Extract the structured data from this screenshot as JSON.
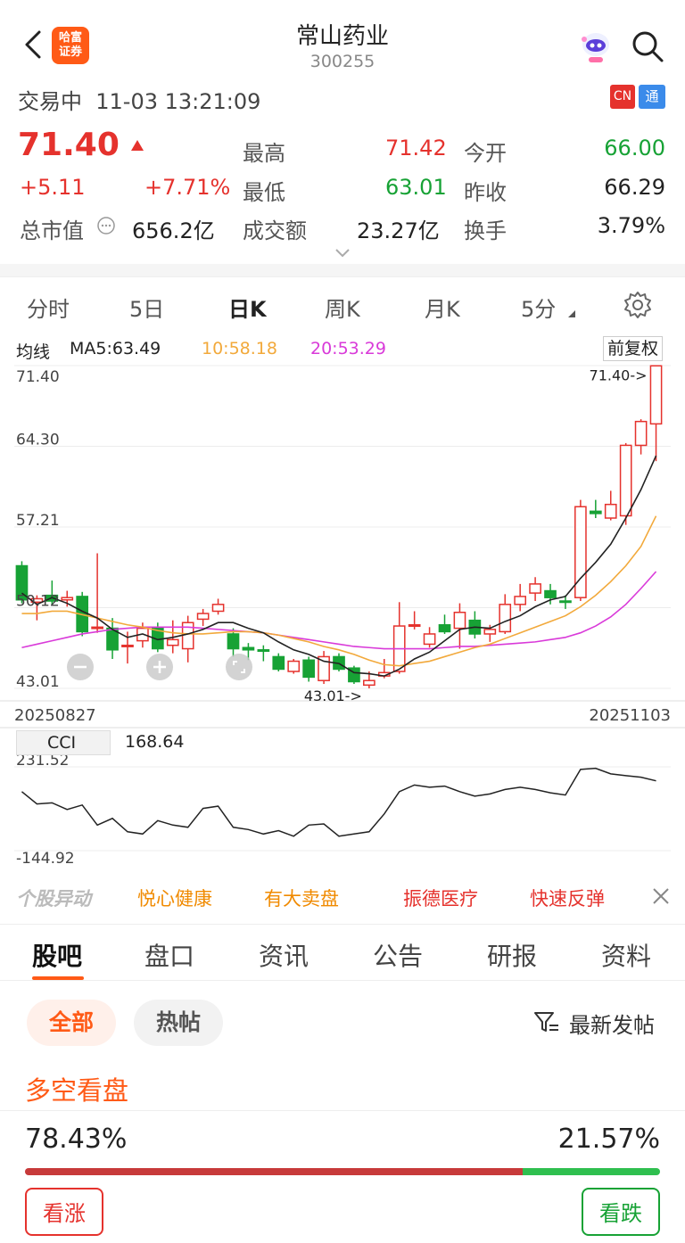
{
  "header": {
    "logo_text": "哈富\n证券",
    "title": "常山药业",
    "code": "300255"
  },
  "status": {
    "text": "交易中  11-03 13:21:09",
    "badge_cn": "CN",
    "badge_tong": "通"
  },
  "quote": {
    "price": "71.40",
    "change": "+5.11",
    "change_pct": "+7.71%",
    "market_cap_label": "总市值",
    "market_cap": "656.2亿",
    "high_label": "最高",
    "high": "71.42",
    "low_label": "最低",
    "low": "63.01",
    "turnover_amount_label": "成交额",
    "turnover_amount": "23.27亿",
    "open_label": "今开",
    "open": "66.00",
    "prev_close_label": "昨收",
    "prev_close": "66.29",
    "turnover_rate_label": "换手",
    "turnover_rate": "3.79%"
  },
  "kline_tabs": [
    "分时",
    "5日",
    "日K",
    "周K",
    "月K",
    "5分"
  ],
  "kline_active": "日K",
  "ma_legend": {
    "label": "均线",
    "ma5": "MA5:63.49",
    "ma10": "10:58.18",
    "ma20": "20:53.29",
    "restore": "前复权",
    "colors": {
      "ma5": "#222222",
      "ma10": "#f2a93b",
      "ma20": "#d93ad9"
    }
  },
  "chart_data": {
    "type": "candlestick",
    "y_ticks": [
      "71.40",
      "64.30",
      "57.21",
      "50.12",
      "43.01"
    ],
    "ylim": [
      43.01,
      71.42
    ],
    "date_start": "20250827",
    "date_end": "20251103",
    "max_label": "71.40->",
    "min_label": "43.01->",
    "candles": [
      {
        "o": 53.8,
        "c": 50.8,
        "h": 54.2,
        "l": 50.5
      },
      {
        "o": 50.6,
        "c": 50.9,
        "h": 51.2,
        "l": 49.0
      },
      {
        "o": 51.2,
        "c": 50.7,
        "h": 52.5,
        "l": 50.3
      },
      {
        "o": 50.8,
        "c": 51.0,
        "h": 51.6,
        "l": 50.2
      },
      {
        "o": 51.1,
        "c": 48.0,
        "h": 51.5,
        "l": 47.6
      },
      {
        "o": 48.3,
        "c": 48.4,
        "h": 54.9,
        "l": 47.9
      },
      {
        "o": 48.3,
        "c": 46.4,
        "h": 49.2,
        "l": 45.6
      },
      {
        "o": 46.7,
        "c": 46.8,
        "h": 48.0,
        "l": 45.2
      },
      {
        "o": 47.2,
        "c": 48.3,
        "h": 48.8,
        "l": 46.6
      },
      {
        "o": 48.3,
        "c": 46.5,
        "h": 48.8,
        "l": 46.2
      },
      {
        "o": 46.8,
        "c": 47.3,
        "h": 49.0,
        "l": 46.1
      },
      {
        "o": 46.5,
        "c": 48.8,
        "h": 49.4,
        "l": 45.3
      },
      {
        "o": 49.1,
        "c": 49.6,
        "h": 50.0,
        "l": 48.5
      },
      {
        "o": 49.8,
        "c": 50.4,
        "h": 50.9,
        "l": 49.5
      },
      {
        "o": 47.8,
        "c": 46.5,
        "h": 48.3,
        "l": 45.8
      },
      {
        "o": 46.6,
        "c": 46.4,
        "h": 47.0,
        "l": 45.5
      },
      {
        "o": 46.4,
        "c": 46.3,
        "h": 46.8,
        "l": 45.4
      },
      {
        "o": 45.8,
        "c": 44.7,
        "h": 46.1,
        "l": 44.5
      },
      {
        "o": 44.5,
        "c": 45.4,
        "h": 45.6,
        "l": 44.3
      },
      {
        "o": 45.5,
        "c": 44.0,
        "h": 45.8,
        "l": 43.6
      },
      {
        "o": 43.7,
        "c": 45.8,
        "h": 46.3,
        "l": 43.4
      },
      {
        "o": 45.8,
        "c": 44.7,
        "h": 46.1,
        "l": 44.5
      },
      {
        "o": 44.8,
        "c": 43.6,
        "h": 45.0,
        "l": 43.4
      },
      {
        "o": 43.3,
        "c": 43.7,
        "h": 44.5,
        "l": 43.01
      },
      {
        "o": 44.1,
        "c": 44.4,
        "h": 45.6,
        "l": 43.9
      },
      {
        "o": 44.5,
        "c": 48.5,
        "h": 50.6,
        "l": 44.3
      },
      {
        "o": 48.5,
        "c": 48.6,
        "h": 49.8,
        "l": 48.2
      },
      {
        "o": 46.9,
        "c": 47.8,
        "h": 48.4,
        "l": 46.6
      },
      {
        "o": 48.6,
        "c": 48.0,
        "h": 49.5,
        "l": 47.8
      },
      {
        "o": 48.3,
        "c": 49.7,
        "h": 50.5,
        "l": 46.5
      },
      {
        "o": 49.0,
        "c": 47.8,
        "h": 49.8,
        "l": 47.4
      },
      {
        "o": 47.8,
        "c": 48.2,
        "h": 48.6,
        "l": 47.1
      },
      {
        "o": 48.0,
        "c": 50.4,
        "h": 51.3,
        "l": 47.8
      },
      {
        "o": 50.4,
        "c": 51.1,
        "h": 52.2,
        "l": 49.8
      },
      {
        "o": 51.4,
        "c": 52.2,
        "h": 52.8,
        "l": 50.7
      },
      {
        "o": 51.6,
        "c": 51.0,
        "h": 52.2,
        "l": 50.4
      },
      {
        "o": 50.7,
        "c": 50.6,
        "h": 51.2,
        "l": 50.0
      },
      {
        "o": 51.0,
        "c": 59.0,
        "h": 59.6,
        "l": 50.7
      },
      {
        "o": 58.6,
        "c": 58.4,
        "h": 59.6,
        "l": 58.0
      },
      {
        "o": 58.0,
        "c": 59.2,
        "h": 60.4,
        "l": 57.8
      },
      {
        "o": 58.2,
        "c": 64.4,
        "h": 64.6,
        "l": 57.4
      },
      {
        "o": 64.4,
        "c": 66.5,
        "h": 66.7,
        "l": 63.6
      },
      {
        "o": 66.29,
        "c": 71.4,
        "h": 71.42,
        "l": 63.01
      }
    ],
    "ma5": [
      51.4,
      50.4,
      51.0,
      50.5,
      49.8,
      49.2,
      48.2,
      47.5,
      47.8,
      47.3,
      47.5,
      47.8,
      48.2,
      48.8,
      48.8,
      48.3,
      47.9,
      47.1,
      46.4,
      46.0,
      45.4,
      45.2,
      44.4,
      44.3,
      44.1,
      44.7,
      45.6,
      46.2,
      47.2,
      48.2,
      48.4,
      48.3,
      48.9,
      49.4,
      50.2,
      50.8,
      51.1,
      52.7,
      54.1,
      55.7,
      58.0,
      60.5,
      63.49
    ],
    "ma10": [
      49.6,
      49.6,
      49.8,
      49.8,
      49.5,
      49.2,
      48.9,
      48.6,
      48.4,
      48.1,
      47.9,
      47.8,
      47.8,
      47.9,
      48.0,
      48.0,
      47.9,
      47.7,
      47.4,
      47.1,
      46.7,
      46.4,
      46.0,
      45.5,
      45.1,
      45.0,
      45.2,
      45.4,
      45.8,
      46.2,
      46.6,
      46.9,
      47.4,
      47.9,
      48.4,
      48.9,
      49.4,
      50.2,
      51.2,
      52.4,
      53.8,
      55.5,
      58.18
    ],
    "ma20": [
      46.6,
      46.9,
      47.2,
      47.5,
      47.8,
      48.0,
      48.2,
      48.3,
      48.4,
      48.4,
      48.4,
      48.4,
      48.3,
      48.2,
      48.1,
      48.0,
      47.9,
      47.7,
      47.5,
      47.3,
      47.1,
      46.9,
      46.7,
      46.6,
      46.5,
      46.5,
      46.5,
      46.5,
      46.6,
      46.7,
      46.7,
      46.8,
      46.9,
      47.0,
      47.1,
      47.3,
      47.5,
      47.9,
      48.5,
      49.3,
      50.4,
      51.8,
      53.29
    ]
  },
  "cci": {
    "label": "CCI",
    "value": "168.64",
    "y_top": "231.52",
    "y_bottom": "-144.92",
    "values": [
      120,
      65,
      70,
      40,
      60,
      -30,
      0,
      -60,
      -70,
      -10,
      -30,
      -40,
      45,
      55,
      -40,
      -50,
      -70,
      -55,
      -80,
      -30,
      -25,
      -80,
      -70,
      -60,
      20,
      120,
      150,
      140,
      145,
      120,
      100,
      110,
      130,
      140,
      130,
      115,
      105,
      220,
      225,
      200,
      192,
      185,
      168.64
    ],
    "ylim": [
      -144.92,
      231.52
    ],
    "color": "#222222"
  },
  "news": {
    "logo": "个股异动",
    "items": [
      "悦心健康",
      "有大卖盘",
      "振德医疗",
      "快速反弹"
    ]
  },
  "bottom_tabs": [
    "股吧",
    "盘口",
    "资讯",
    "公告",
    "研报",
    "资料"
  ],
  "bottom_active": "股吧",
  "filters": {
    "all": "全部",
    "hot": "热帖",
    "sort": "最新发帖"
  },
  "vote": {
    "heading": "多空看盘",
    "bull_pct": "78.43%",
    "bear_pct": "21.57%",
    "bull_fraction": 0.7843,
    "bull_btn": "看涨",
    "bear_btn": "看跌",
    "bull_color": "#c73a3a",
    "bear_color": "#2fbf4f"
  }
}
